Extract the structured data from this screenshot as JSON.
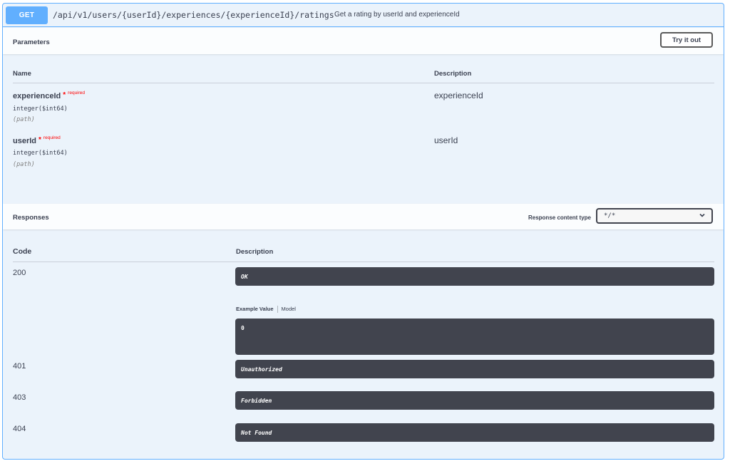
{
  "summary": {
    "method": "GET",
    "path": "/api/v1/users/{userId}/experiences/{experienceId}/ratings",
    "description": "Get a rating by userId and experienceId"
  },
  "parameters": {
    "title": "Parameters",
    "try_button": "Try it out",
    "col_name": "Name",
    "col_description": "Description",
    "items": [
      {
        "name": "experienceId",
        "required_star": "*",
        "required_label": "required",
        "type": "integer($int64)",
        "in": "(path)",
        "description": "experienceId"
      },
      {
        "name": "userId",
        "required_star": "*",
        "required_label": "required",
        "type": "integer($int64)",
        "in": "(path)",
        "description": "userId"
      }
    ]
  },
  "responses": {
    "title": "Responses",
    "content_type_label": "Response content type",
    "content_type_value": "*/*",
    "col_code": "Code",
    "col_description": "Description",
    "example_tab": "Example Value",
    "model_tab": "Model",
    "example_value": "0",
    "items": [
      {
        "code": "200",
        "description": "OK"
      },
      {
        "code": "401",
        "description": "Unauthorized"
      },
      {
        "code": "403",
        "description": "Forbidden"
      },
      {
        "code": "404",
        "description": "Not Found"
      }
    ]
  },
  "colors": {
    "get_accent": "#61affe",
    "block_bg": "#ebf3fb",
    "code_bg": "#41444e",
    "required": "#ff0000"
  },
  "icons": {
    "select_chevron": "chevron-down-icon"
  }
}
